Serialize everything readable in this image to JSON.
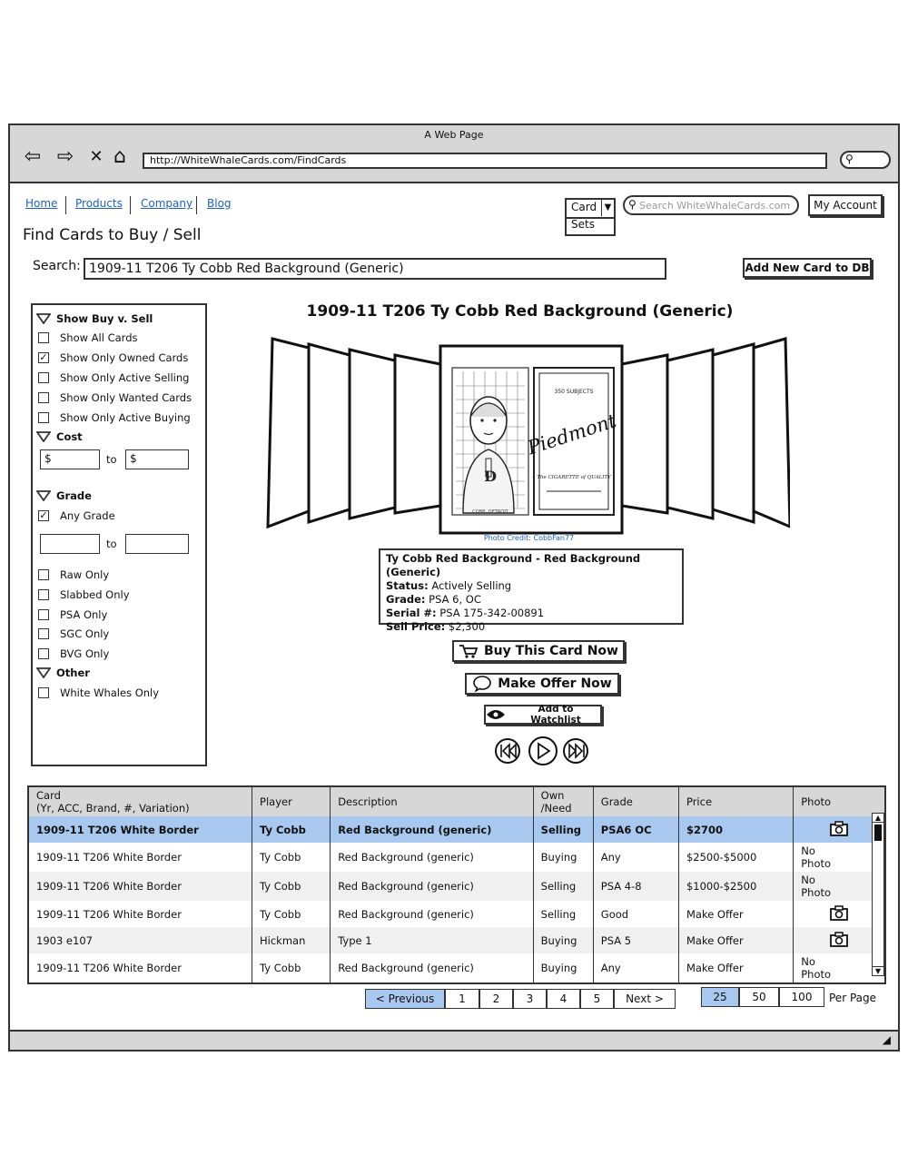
{
  "browser": {
    "title": "A Web Page",
    "url": "http://WhiteWhaleCards.com/FindCards"
  },
  "nav": {
    "home": "Home",
    "products": "Products",
    "company": "Company",
    "blog": "Blog"
  },
  "header": {
    "search_type_selected": "Card",
    "search_type_option2": "Sets",
    "site_search_placeholder": "Search WhiteWhaleCards.com",
    "my_account": "My Account"
  },
  "page": {
    "title": "Find Cards to Buy / Sell",
    "search_label": "Search:",
    "search_value": "1909-11 T206 Ty Cobb Red Background (Generic)",
    "add_card": "Add New Card to DB"
  },
  "filters": {
    "show_header": "Show Buy v. Sell",
    "show_options": [
      {
        "label": "Show All Cards",
        "checked": false
      },
      {
        "label": "Show Only Owned Cards",
        "checked": true
      },
      {
        "label": "Show Only Active Selling",
        "checked": false
      },
      {
        "label": "Show Only Wanted Cards",
        "checked": false
      },
      {
        "label": "Show Only Active Buying",
        "checked": false
      }
    ],
    "cost_header": "Cost",
    "cost_from": "$",
    "cost_to_label": "to",
    "cost_to": "$",
    "grade_header": "Grade",
    "any_grade": "Any Grade",
    "grade_to_label": "to",
    "grade_options": [
      "Raw Only",
      "Slabbed Only",
      "PSA Only",
      "SGC Only",
      "BVG Only"
    ],
    "other_header": "Other",
    "other_options": [
      "White Whales Only"
    ]
  },
  "detail": {
    "title": "1909-11 T206 Ty Cobb Red Background (Generic)",
    "photo_credit": "Photo Credit: CobbFan77",
    "card_back_text": "Piedmont",
    "card_back_sub": "The CIGARETTE of QUALITY",
    "card_back_top": "350 SUBJECTS",
    "card_front_caption": "COBB, DETROIT",
    "info_title": "Ty Cobb Red Background - Red Background (Generic)",
    "status_label": "Status:",
    "status_value": "Actively Selling",
    "grade_label": "Grade:",
    "grade_value": "PSA 6, OC",
    "serial_label": "Serial #:",
    "serial_value": "PSA 175-342-00891",
    "price_label": "Sell Price:",
    "price_value": "$2,300",
    "buy_button": "Buy This Card Now",
    "offer_button": "Make Offer Now",
    "watch_button": "Add to Watchlist"
  },
  "table": {
    "headers": {
      "card_line1": "Card",
      "card_line2": "(Yr, ACC, Brand, #, Variation)",
      "player": "Player",
      "description": "Description",
      "own_line1": "Own",
      "own_line2": "/Need",
      "grade": "Grade",
      "price": "Price",
      "photo": "Photo"
    },
    "rows": [
      {
        "card": "1909-11 T206 White Border",
        "player": "Ty Cobb",
        "description": "Red Background (generic)",
        "own": "Selling",
        "grade": "PSA6 OC",
        "price": "$2700",
        "photo": "camera"
      },
      {
        "card": "1909-11 T206 White Border",
        "player": "Ty Cobb",
        "description": "Red Background (generic)",
        "own": "Buying",
        "grade": "Any",
        "price": "$2500-$5000",
        "photo": "No Photo"
      },
      {
        "card": "1909-11 T206 White Border",
        "player": "Ty Cobb",
        "description": "Red Background (generic)",
        "own": "Selling",
        "grade": "PSA 4-8",
        "price": "$1000-$2500",
        "photo": "No Photo"
      },
      {
        "card": "1909-11 T206 White Border",
        "player": "Ty Cobb",
        "description": "Red Background (generic)",
        "own": "Selling",
        "grade": "Good",
        "price": "Make Offer",
        "photo": "camera"
      },
      {
        "card": "1903 e107",
        "player": "Hickman",
        "description": "Type 1",
        "own": "Buying",
        "grade": "PSA 5",
        "price": "Make Offer",
        "photo": "camera"
      },
      {
        "card": "1909-11 T206 White Border",
        "player": "Ty Cobb",
        "description": "Red Background (generic)",
        "own": "Buying",
        "grade": "Any",
        "price": "Make Offer",
        "photo": "No Photo"
      }
    ]
  },
  "pagination": {
    "previous": "< Previous",
    "pages": [
      "1",
      "2",
      "3",
      "4",
      "5"
    ],
    "next": "Next >",
    "per_page_options": [
      "25",
      "50",
      "100"
    ],
    "per_page_selected": "25",
    "per_page_label": "Per Page"
  }
}
